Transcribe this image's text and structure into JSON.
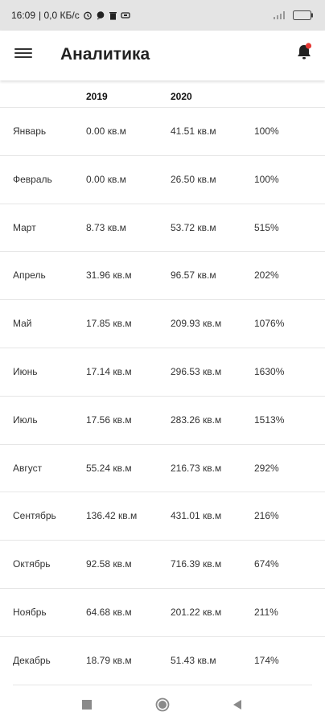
{
  "status_bar": {
    "time": "16:09",
    "network_speed": "| 0,0 КБ/с",
    "battery": "83"
  },
  "app_bar": {
    "title": "Аналитика",
    "accent_color": "#e53935"
  },
  "table": {
    "headers": [
      "",
      "2019",
      "2020",
      ""
    ],
    "rows": [
      {
        "month": "Январь",
        "y2019": "0.00 кв.м",
        "y2020": "41.51 кв.м",
        "pct": "100%"
      },
      {
        "month": "Февраль",
        "y2019": "0.00 кв.м",
        "y2020": "26.50 кв.м",
        "pct": "100%"
      },
      {
        "month": "Март",
        "y2019": "8.73 кв.м",
        "y2020": "53.72 кв.м",
        "pct": "515%"
      },
      {
        "month": "Апрель",
        "y2019": "31.96 кв.м",
        "y2020": "96.57 кв.м",
        "pct": "202%"
      },
      {
        "month": "Май",
        "y2019": "17.85 кв.м",
        "y2020": "209.93 кв.м",
        "pct": "1076%"
      },
      {
        "month": "Июнь",
        "y2019": "17.14 кв.м",
        "y2020": "296.53 кв.м",
        "pct": "1630%"
      },
      {
        "month": "Июль",
        "y2019": "17.56 кв.м",
        "y2020": "283.26 кв.м",
        "pct": "1513%"
      },
      {
        "month": "Август",
        "y2019": "55.24 кв.м",
        "y2020": "216.73 кв.м",
        "pct": "292%"
      },
      {
        "month": "Сентябрь",
        "y2019": "136.42 кв.м",
        "y2020": "431.01 кв.м",
        "pct": "216%"
      },
      {
        "month": "Октябрь",
        "y2019": "92.58 кв.м",
        "y2020": "716.39 кв.м",
        "pct": "674%"
      },
      {
        "month": "Ноябрь",
        "y2019": "64.68 кв.м",
        "y2020": "201.22 кв.м",
        "pct": "211%"
      },
      {
        "month": "Декабрь",
        "y2019": "18.79 кв.м",
        "y2020": "51.43 кв.м",
        "pct": "174%"
      }
    ]
  },
  "icons": {
    "menu": "hamburger-menu-icon",
    "notifications": "bell-icon",
    "nav_recent": "square-icon",
    "nav_home": "circle-icon",
    "nav_back": "triangle-back-icon"
  }
}
